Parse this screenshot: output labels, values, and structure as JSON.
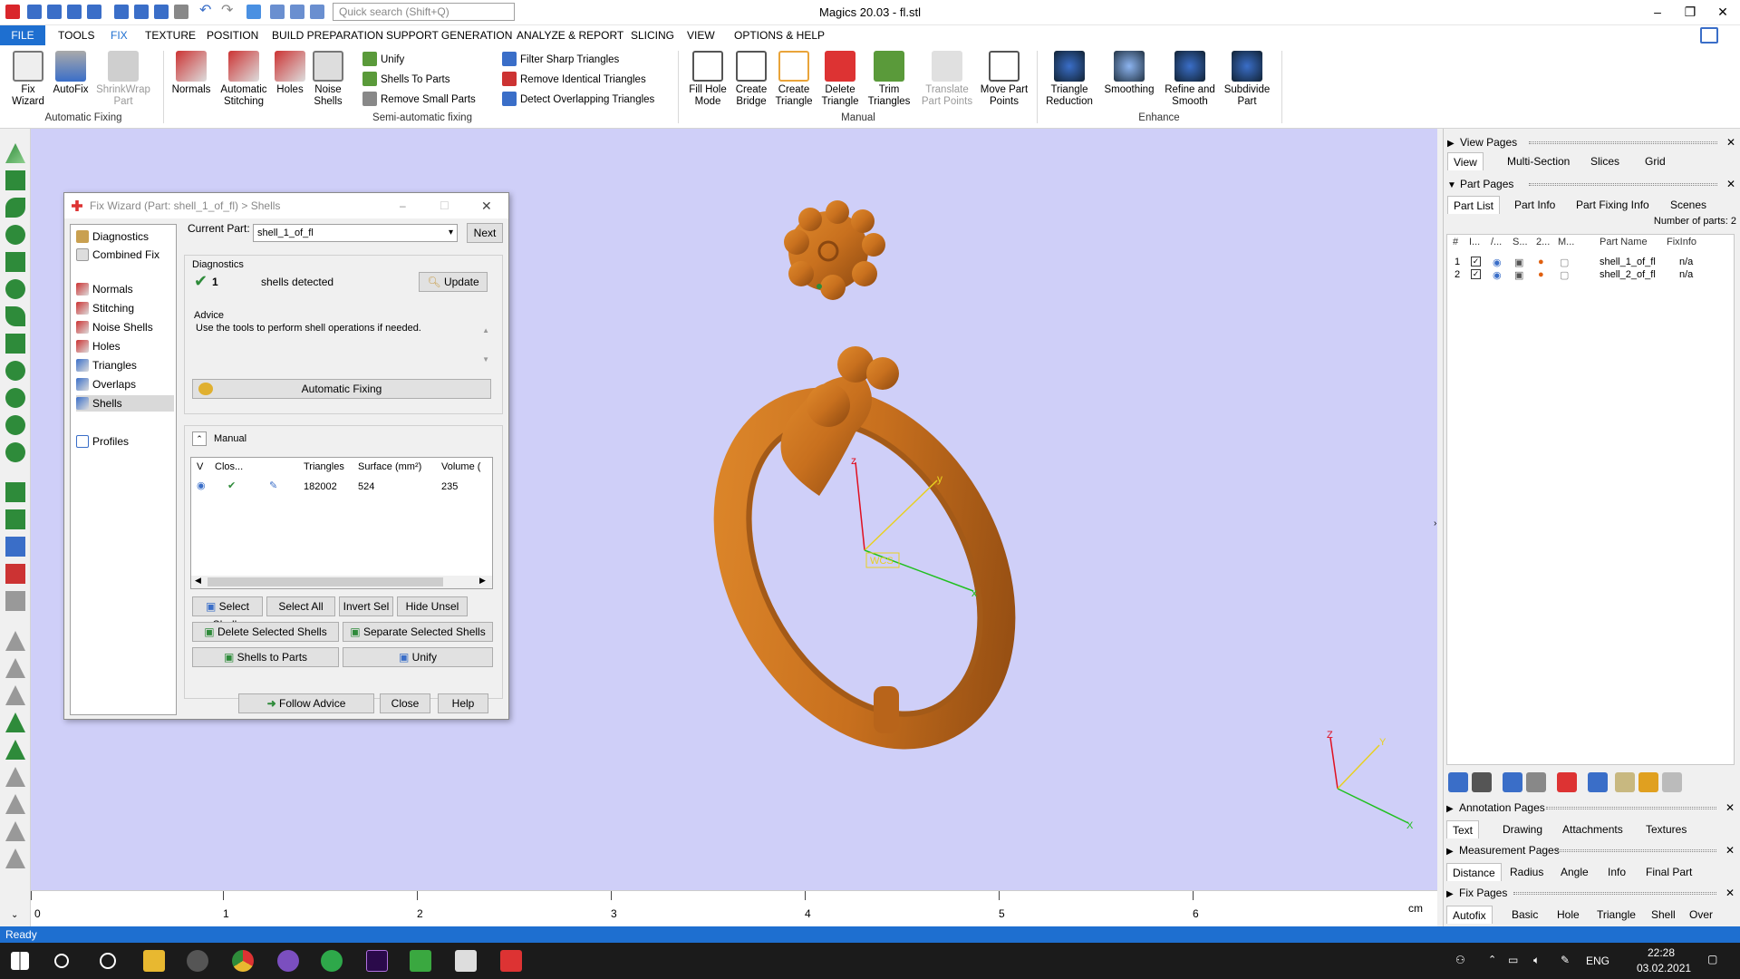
{
  "window": {
    "title": "Magics 20.03 - fl.stl",
    "search_placeholder": "Quick search (Shift+Q)"
  },
  "menu": {
    "items": [
      "FILE",
      "TOOLS",
      "FIX",
      "TEXTURE",
      "POSITION",
      "BUILD PREPARATION",
      "SUPPORT GENERATION",
      "ANALYZE & REPORT",
      "SLICING",
      "VIEW",
      "OPTIONS & HELP"
    ],
    "active": "FIX"
  },
  "ribbon": {
    "automatic_fixing": {
      "label": "Automatic Fixing",
      "buttons": [
        "Fix\nWizard",
        "AutoFix",
        "ShrinkWrap\nPart"
      ]
    },
    "semi_automatic": {
      "label": "Semi-automatic fixing",
      "buttons": [
        "Normals",
        "Automatic\nStitching",
        "Holes",
        "Noise\nShells"
      ],
      "small": [
        "Unify",
        "Shells To Parts",
        "Remove Small Parts",
        "Filter Sharp Triangles",
        "Remove Identical Triangles",
        "Detect Overlapping Triangles"
      ]
    },
    "manual": {
      "label": "Manual",
      "buttons": [
        "Fill Hole\nMode",
        "Create\nBridge",
        "Create\nTriangle",
        "Delete\nTriangle",
        "Trim\nTriangles",
        "Translate\nPart Points",
        "Move Part\nPoints"
      ]
    },
    "enhance": {
      "label": "Enhance",
      "buttons": [
        "Triangle\nReduction",
        "Smoothing",
        "Refine and\nSmooth",
        "Subdivide\nPart"
      ]
    }
  },
  "dialog": {
    "title": "Fix Wizard (Part: shell_1_of_fl) > Shells",
    "nav": [
      "Diagnostics",
      "Combined Fix",
      "Normals",
      "Stitching",
      "Noise Shells",
      "Holes",
      "Triangles",
      "Overlaps",
      "Shells",
      "Profiles"
    ],
    "selected_nav": "Shells",
    "current_part_label": "Current Part:",
    "current_part": "shell_1_of_fl",
    "next": "Next",
    "diagnostics_label": "Diagnostics",
    "shell_count": "1",
    "shells_detected": "shells detected",
    "update": "Update",
    "advice_label": "Advice",
    "advice_text": "Use the tools to perform shell operations if needed.",
    "automatic_fixing": "Automatic Fixing",
    "manual_label": "Manual",
    "table_headers": [
      "V",
      "Clos...",
      "",
      "Triangles",
      "Surface (mm²)",
      "Volume ("
    ],
    "table_row": {
      "triangles": "182002",
      "surface": "524",
      "volume": "235"
    },
    "buttons": {
      "select_shells": "Select Shells",
      "select_all": "Select All",
      "invert_sel": "Invert Sel",
      "hide_unsel": "Hide Unsel",
      "delete_selected": "Delete Selected Shells",
      "separate_selected": "Separate Selected Shells",
      "shells_to_parts": "Shells to Parts",
      "unify": "Unify",
      "follow_advice": "Follow Advice",
      "close": "Close",
      "help": "Help"
    }
  },
  "viewport": {
    "axis_labels": [
      "z",
      "y",
      "x",
      "WCS"
    ],
    "mini_axes": [
      "Z",
      "Y",
      "X"
    ],
    "model_color": "#c8701e",
    "background": "#cfcff8"
  },
  "ruler": {
    "labels": [
      "0",
      "1",
      "2",
      "3",
      "4",
      "5",
      "6"
    ],
    "unit": "cm"
  },
  "right_panel": {
    "view_pages": {
      "label": "View Pages",
      "tabs": [
        "View",
        "Multi-Section",
        "Slices",
        "Grid"
      ]
    },
    "part_pages": {
      "label": "Part Pages",
      "tabs": [
        "Part List",
        "Part Info",
        "Part Fixing Info",
        "Scenes"
      ],
      "count_text": "Number of parts: 2"
    },
    "part_list_headers": [
      "#",
      "I...",
      "/...",
      "S...",
      "2...",
      "M...",
      "Part Name",
      "FixInfo"
    ],
    "parts": [
      {
        "num": "1",
        "name": "shell_1_of_fl",
        "fixinfo": "n/a"
      },
      {
        "num": "2",
        "name": "shell_2_of_fl",
        "fixinfo": "n/a"
      }
    ],
    "annotation_pages": {
      "label": "Annotation Pages",
      "tabs": [
        "Text",
        "Drawing",
        "Attachments",
        "Textures"
      ]
    },
    "measurement_pages": {
      "label": "Measurement Pages",
      "tabs": [
        "Distance",
        "Radius",
        "Angle",
        "Info",
        "Final Part"
      ]
    },
    "fix_pages": {
      "label": "Fix Pages",
      "tabs": [
        "Autofix",
        "Basic",
        "Hole",
        "Triangle",
        "Shell",
        "Over"
      ]
    }
  },
  "status": {
    "text": "Ready"
  },
  "taskbar": {
    "lang": "ENG",
    "time": "22:28",
    "date": "03.02.2021"
  }
}
